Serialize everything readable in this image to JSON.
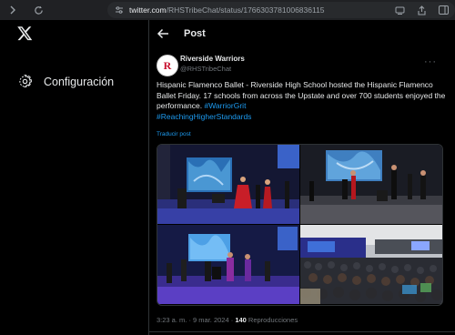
{
  "browser": {
    "url_host": "twitter.com",
    "url_path": "/RHSTribeChat/status/1766303781006836115"
  },
  "sidebar": {
    "settings_label": "Configuración"
  },
  "header": {
    "title": "Post"
  },
  "tweet": {
    "author_name": "Riverside Warriors",
    "author_handle": "@RHSTribeChat",
    "avatar_letter": "R",
    "text": "Hispanic Flamenco Ballet - Riverside High School hosted the Hispanic Flamenco Ballet Friday. 17 schools from across the Upstate and over 700 students enjoyed the performance.",
    "hashtags": [
      "#WarriorGrit",
      "#ReachingHigherStandards"
    ],
    "translate_label": "Traducir post",
    "time": "3:23 a. m.",
    "date": "9 mar. 2024",
    "views_count": "140",
    "views_label": "Reproducciones"
  },
  "colors": {
    "accent": "#1d9bf0",
    "background": "#000000",
    "text": "#e7e9ea",
    "muted": "#71767b"
  }
}
